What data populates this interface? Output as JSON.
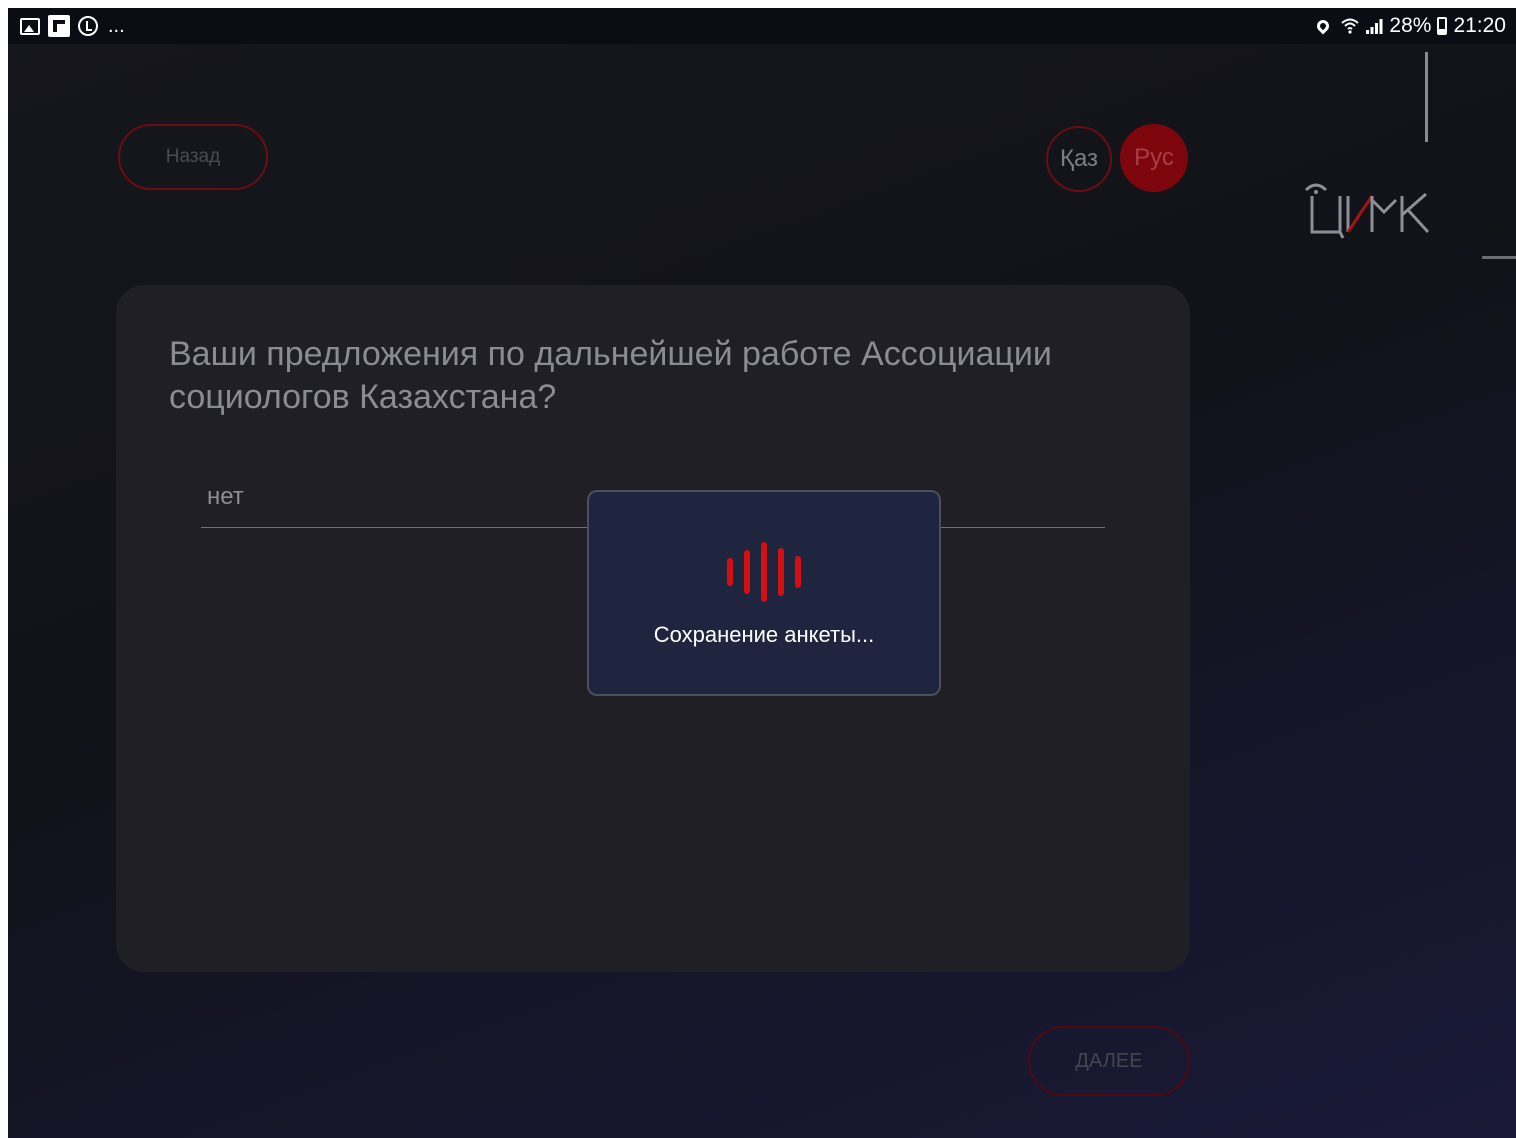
{
  "status_bar": {
    "left_icons": [
      "gallery-icon",
      "flipboard-icon",
      "sync-icon"
    ],
    "more": "...",
    "battery_percent": "28%",
    "time": "21:20"
  },
  "header": {
    "back_label": "Назад",
    "lang_kaz": "Қаз",
    "lang_rus": "Рус",
    "logo_text": "ЦИМК"
  },
  "question": {
    "text": "Ваши предложения по дальнейшей работе Ассоциации социологов Казахстана?",
    "answer": "нет"
  },
  "footer": {
    "next_label": "ДАЛЕЕ"
  },
  "modal": {
    "message": "Сохранение анкеты..."
  },
  "colors": {
    "accent": "#d20f12",
    "background": "#16161d",
    "card": "#1f1f25",
    "modal": "#20253f"
  }
}
